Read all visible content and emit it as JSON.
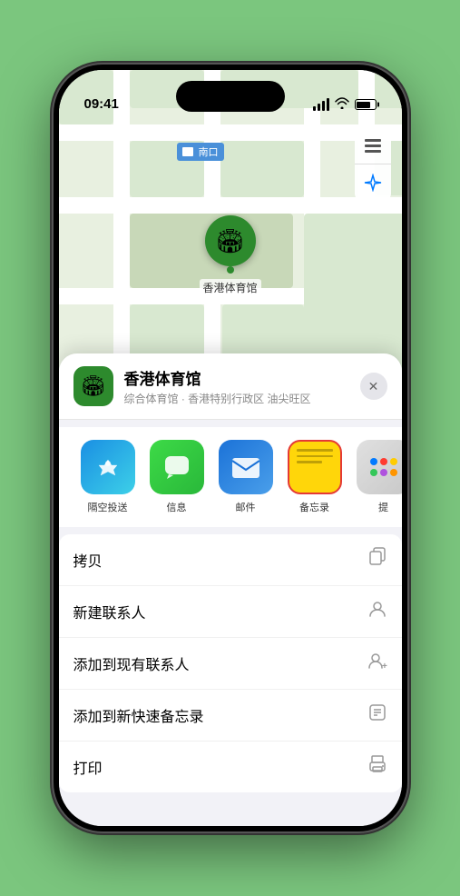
{
  "status_bar": {
    "time": "09:41",
    "location_arrow": "▲"
  },
  "map": {
    "label": "南口",
    "pin_emoji": "🏟",
    "pin_label": "香港体育馆"
  },
  "map_controls": {
    "layers_icon": "🗺",
    "location_icon": "➤"
  },
  "location_card": {
    "icon": "🏟",
    "name": "香港体育馆",
    "subtitle": "综合体育馆 · 香港特别行政区 油尖旺区",
    "close_label": "✕"
  },
  "share_items": [
    {
      "id": "airdrop",
      "label": "隔空投送",
      "type": "airdrop"
    },
    {
      "id": "messages",
      "label": "信息",
      "type": "messages"
    },
    {
      "id": "mail",
      "label": "邮件",
      "type": "mail"
    },
    {
      "id": "notes",
      "label": "备忘录",
      "type": "notes"
    },
    {
      "id": "more",
      "label": "提",
      "type": "more"
    }
  ],
  "action_items": [
    {
      "id": "copy",
      "label": "拷贝",
      "icon": "⧉"
    },
    {
      "id": "new-contact",
      "label": "新建联系人",
      "icon": "👤"
    },
    {
      "id": "add-existing",
      "label": "添加到现有联系人",
      "icon": "👤"
    },
    {
      "id": "add-quick-note",
      "label": "添加到新快速备忘录",
      "icon": "📋"
    },
    {
      "id": "print",
      "label": "打印",
      "icon": "🖨"
    }
  ]
}
